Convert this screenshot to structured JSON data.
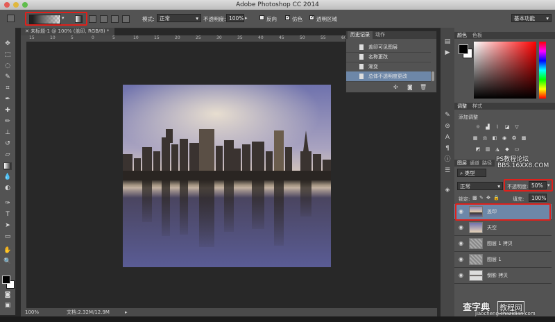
{
  "app": {
    "title": "Adobe Photoshop CC 2014"
  },
  "options_bar": {
    "mode_label": "模式:",
    "mode_value": "正常",
    "opacity_label": "不透明度:",
    "opacity_value": "100%",
    "reverse_label": "反向",
    "dither_label": "仿色",
    "transparency_label": "透明区域",
    "workspace_value": "基本功能"
  },
  "document": {
    "tab_title": "未标题-1 @ 100% (盖印, RGB/8) *",
    "ruler_numbers": [
      "15",
      "10",
      "5",
      "0",
      "5",
      "10",
      "15",
      "20",
      "25",
      "30",
      "35",
      "40",
      "45",
      "50",
      "55",
      "60",
      "65",
      "70",
      "75"
    ],
    "zoom": "100%",
    "doc_size": "文档:2.32M/12.9M"
  },
  "history_panel": {
    "tabs": [
      "历史记录",
      "动作"
    ],
    "items": [
      "盖印可见图层",
      "名称更改",
      "渐变",
      "总体不透明度更改"
    ],
    "selected_index": 3
  },
  "color_panel": {
    "tabs": [
      "颜色",
      "色板"
    ]
  },
  "adjustments_panel": {
    "tabs": [
      "调整",
      "样式"
    ],
    "add_label": "添加调整"
  },
  "layers_panel": {
    "tabs": [
      "图层",
      "通道",
      "路径"
    ],
    "filter_kind": "类型",
    "blend_mode": "正常",
    "opacity_label": "不透明度:",
    "opacity_value": "50%",
    "lock_label": "锁定:",
    "fill_label": "填充:",
    "fill_value": "100%",
    "layers": [
      "盖印",
      "天空",
      "图层 1 拷贝",
      "图层 1",
      "倒影 拷贝"
    ],
    "selected_index": 0
  },
  "watermarks": {
    "site1_name": "PS教程论坛",
    "site1_url": "BBS.16XX8.COM",
    "site2_name": "查字典",
    "site2_label": "教程网",
    "site2_url": "jiaocheng.chazidian.com"
  },
  "colors": {
    "accent_red": "#e0201b",
    "selection_blue": "#6d87a8",
    "panel_gray": "#535353"
  }
}
